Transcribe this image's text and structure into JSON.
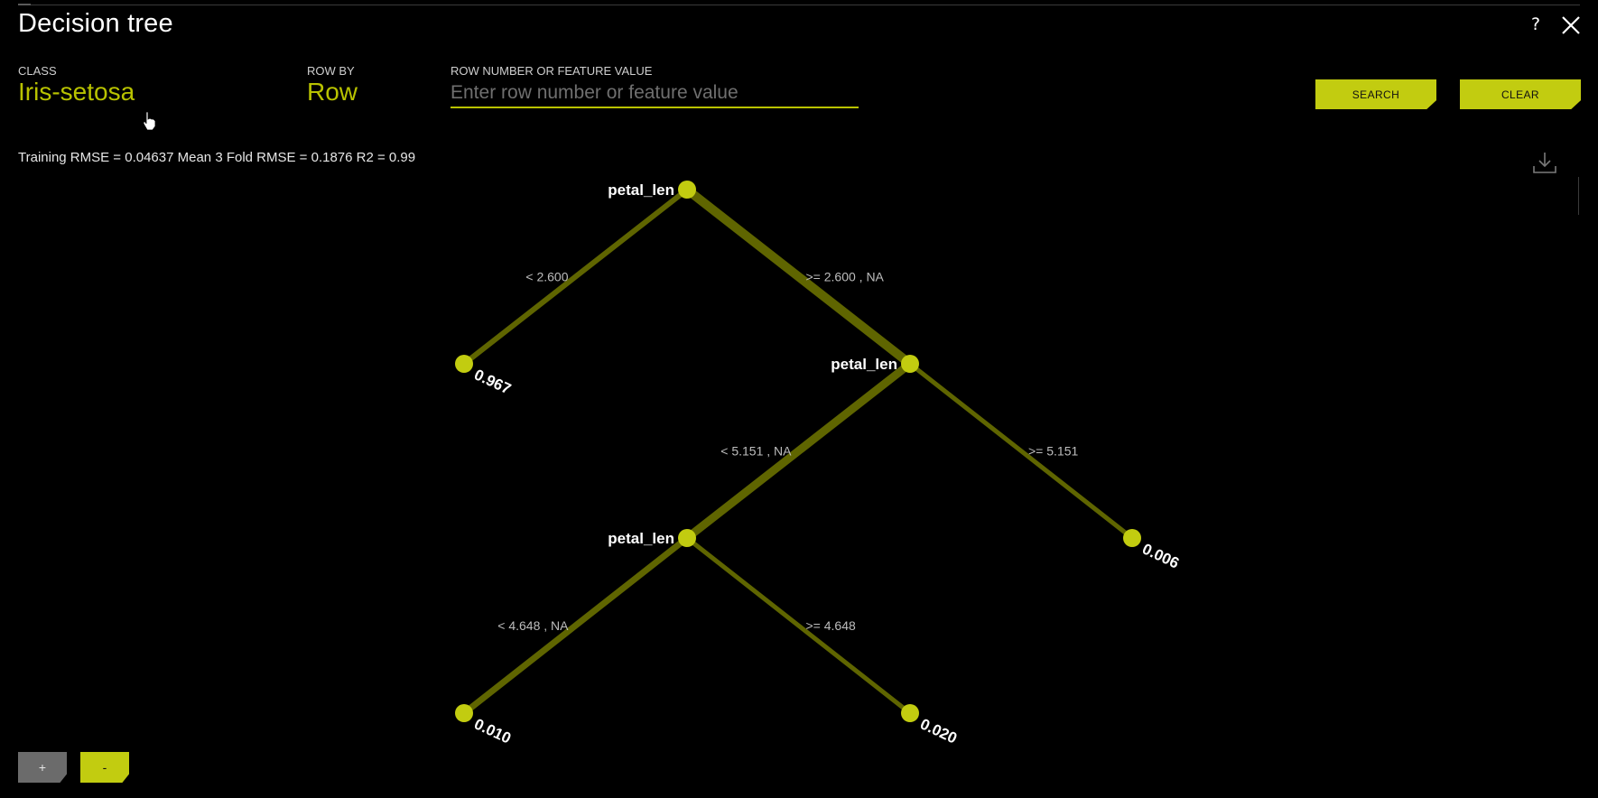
{
  "dialog": {
    "title": "Decision tree",
    "help_label": "?"
  },
  "fields": {
    "class_label": "CLASS",
    "class_value": "Iris-setosa",
    "row_by_label": "ROW BY",
    "row_by_value": "Row",
    "row_number_label": "ROW NUMBER OR FEATURE VALUE",
    "row_number_placeholder": "Enter row number or feature value",
    "row_number_value": ""
  },
  "buttons": {
    "search": "SEARCH",
    "clear": "CLEAR",
    "zoom_in": "+",
    "zoom_out": "-"
  },
  "metrics_text": "Training RMSE = 0.04637 Mean 3 Fold RMSE = 0.1876 R2 = 0.99",
  "tree": {
    "node_color": "#c2cc10",
    "edge_color": "#5f6500",
    "nodes": [
      {
        "id": "n0",
        "label": "petal_len",
        "type": "split"
      },
      {
        "id": "n1",
        "label": "0.967",
        "type": "leaf"
      },
      {
        "id": "n2",
        "label": "petal_len",
        "type": "split"
      },
      {
        "id": "n3",
        "label": "petal_len",
        "type": "split"
      },
      {
        "id": "n4",
        "label": "0.006",
        "type": "leaf"
      },
      {
        "id": "n5",
        "label": "0.010",
        "type": "leaf"
      },
      {
        "id": "n6",
        "label": "0.020",
        "type": "leaf"
      }
    ],
    "edges": [
      {
        "from": "n0",
        "to": "n1",
        "label": "< 2.600"
      },
      {
        "from": "n0",
        "to": "n2",
        "label": ">= 2.600 , NA"
      },
      {
        "from": "n2",
        "to": "n3",
        "label": "< 5.151 , NA"
      },
      {
        "from": "n2",
        "to": "n4",
        "label": ">= 5.151"
      },
      {
        "from": "n3",
        "to": "n5",
        "label": "< 4.648 , NA"
      },
      {
        "from": "n3",
        "to": "n6",
        "label": ">= 4.648"
      }
    ]
  },
  "colors": {
    "accent": "#c2cc10",
    "background": "#000000"
  }
}
